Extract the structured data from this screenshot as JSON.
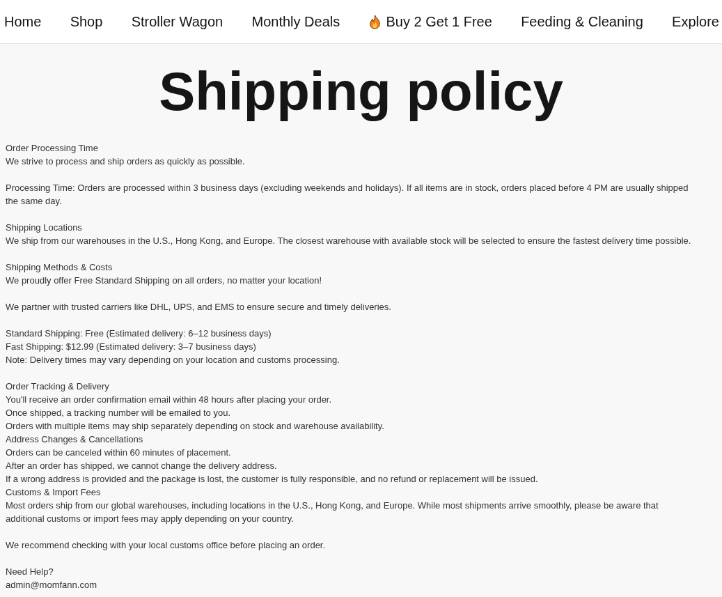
{
  "nav": [
    {
      "label": "Home",
      "kind": "plain"
    },
    {
      "label": "Shop",
      "kind": "plain"
    },
    {
      "label": "Stroller Wagon",
      "kind": "plain"
    },
    {
      "label": "Monthly Deals",
      "kind": "plain"
    },
    {
      "label": "Buy 2 Get 1 Free",
      "kind": "promo"
    },
    {
      "label": "Feeding & Cleaning",
      "kind": "plain"
    },
    {
      "label": "Explore",
      "kind": "plain"
    }
  ],
  "title": "Shipping policy",
  "blocks": [
    [
      "Order Processing Time",
      "We strive to process and ship orders as quickly as possible."
    ],
    [
      "Processing Time: Orders are processed within 3 business days (excluding weekends and holidays). If all items are in stock, orders placed before 4 PM are usually shipped the same day."
    ],
    [
      "Shipping Locations",
      "We ship from our warehouses in the U.S., Hong Kong, and Europe. The closest warehouse with available stock will be selected to ensure the fastest delivery time possible."
    ],
    [
      "Shipping Methods & Costs",
      "We proudly offer Free Standard Shipping on all orders, no matter your location!"
    ],
    [
      "We partner with trusted carriers like DHL, UPS, and EMS to ensure secure and timely deliveries."
    ],
    [
      "Standard Shipping: Free (Estimated delivery: 6–12 business days)",
      "Fast Shipping: $12.99 (Estimated delivery: 3–7 business days)",
      "Note: Delivery times may vary depending on your location and customs processing."
    ],
    [
      "Order Tracking & Delivery",
      "You'll receive an order confirmation email within 48 hours after placing your order.",
      "Once shipped, a tracking number will be emailed to you.",
      "Orders with multiple items may ship separately depending on stock and warehouse availability.",
      "Address Changes & Cancellations",
      "Orders can be canceled within 60 minutes of placement.",
      "After an order has shipped, we cannot change the delivery address.",
      "If a wrong address is provided and the package is lost, the customer is fully responsible, and no refund or replacement will be issued.",
      "Customs & Import Fees",
      "Most orders ship from our global warehouses, including locations in the U.S., Hong Kong, and Europe. While most shipments arrive smoothly, please be aware that additional customs or import fees may apply depending on your country."
    ],
    [
      "We recommend checking with your local customs office before placing an order."
    ],
    [
      "Need Help?",
      "admin@momfann.com"
    ]
  ]
}
